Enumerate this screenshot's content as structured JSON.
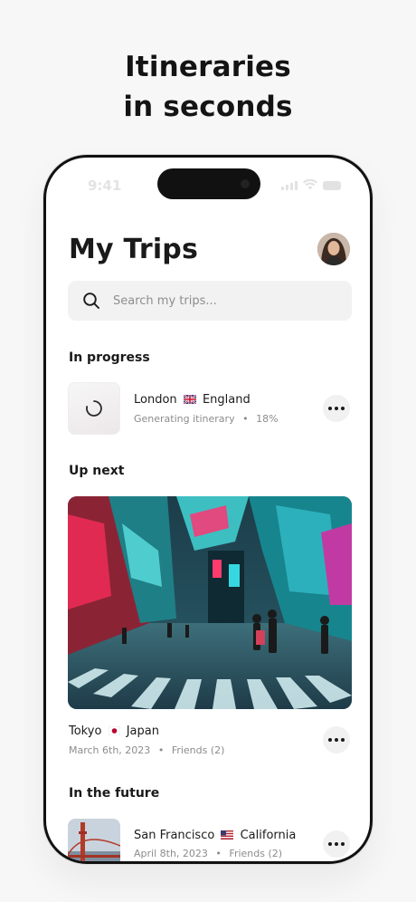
{
  "headline": {
    "line1": "Itineraries",
    "line2": "in seconds"
  },
  "status_bar": {
    "time": "9:41"
  },
  "page": {
    "title": "My Trips"
  },
  "search": {
    "placeholder": "Search my trips..."
  },
  "sections": {
    "in_progress": "In progress",
    "up_next": "Up next",
    "in_the_future": "In the future"
  },
  "trips": {
    "london": {
      "city": "London",
      "country": "England",
      "status": "Generating itinerary",
      "progress": "18%"
    },
    "tokyo": {
      "city": "Tokyo",
      "country": "Japan",
      "date": "March 6th, 2023",
      "companions": "Friends (2)"
    },
    "sf": {
      "city": "San Francisco",
      "country": "California",
      "date": "April 8th, 2023",
      "companions": "Friends (2)"
    }
  },
  "icons": {
    "search": "search-icon",
    "more": "more-icon",
    "spinner": "spinner-icon"
  },
  "colors": {
    "accent": "#1a1a1a",
    "search_bg": "#f2f2f2",
    "meta_text": "#8c8c8c"
  }
}
